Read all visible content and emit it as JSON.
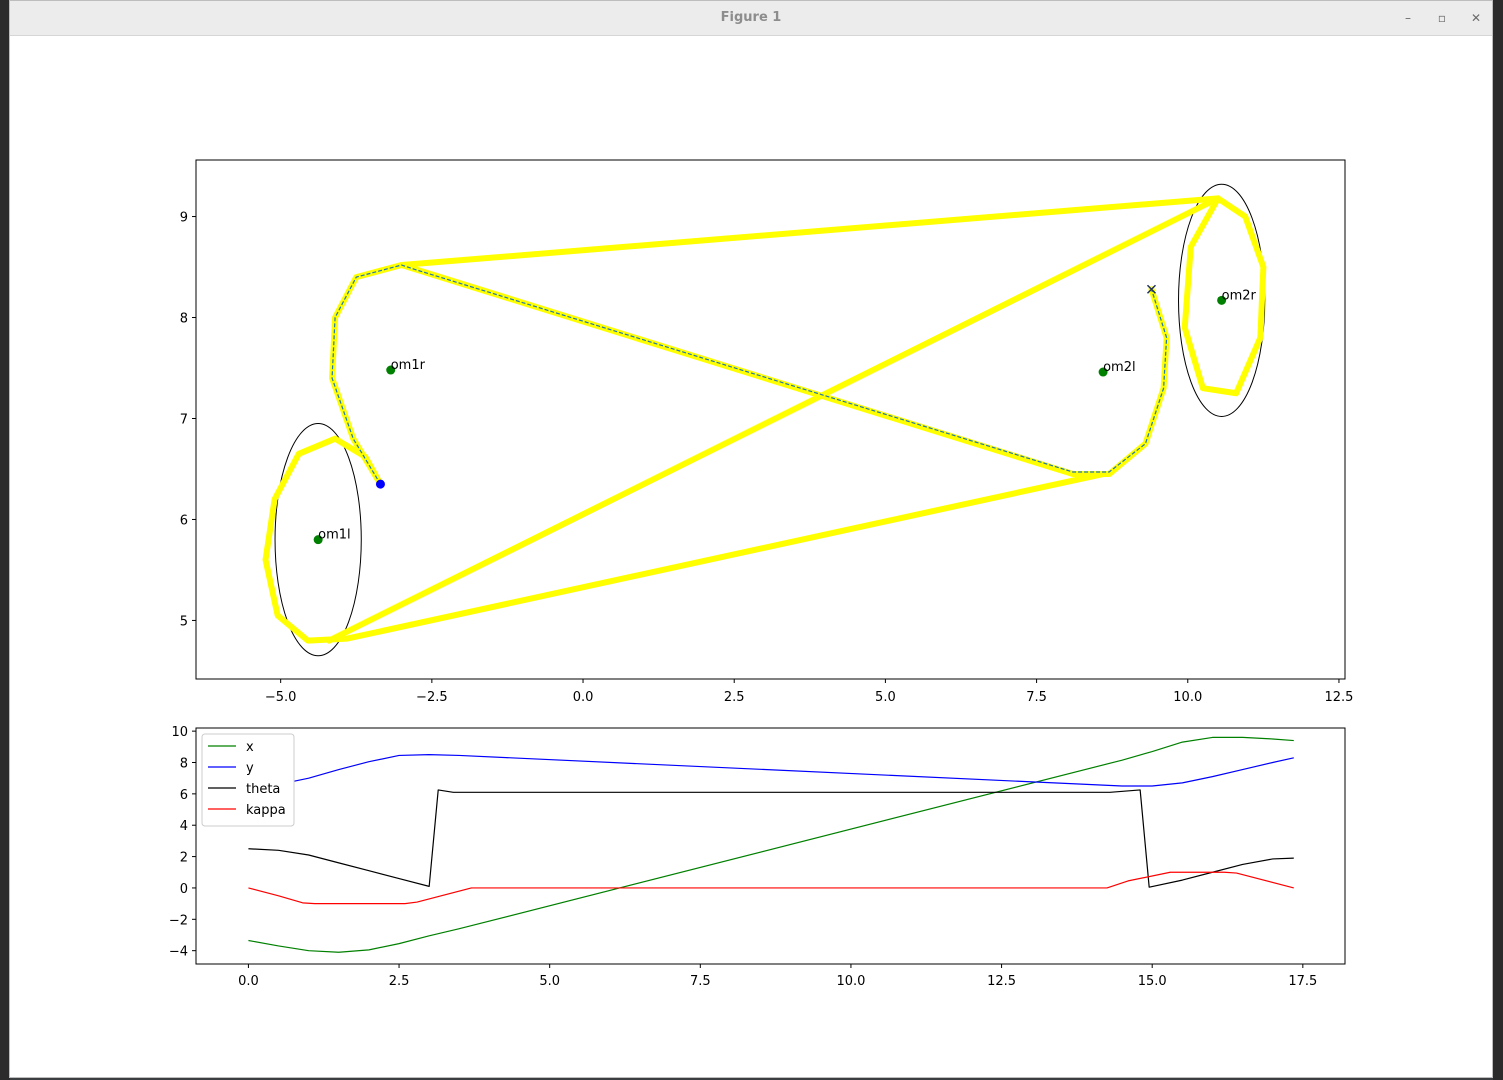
{
  "window": {
    "title": "Figure 1",
    "minimize_glyph": "–",
    "maximize_glyph": "▫",
    "close_glyph": "✕"
  },
  "chart_data": [
    {
      "type": "line",
      "title": "",
      "xlabel": "",
      "ylabel": "",
      "xlim": [
        -6.4,
        12.6
      ],
      "ylim": [
        4.42,
        9.56
      ],
      "xticks": [
        -5.0,
        -2.5,
        0.0,
        2.5,
        5.0,
        7.5,
        10.0,
        12.5
      ],
      "xtick_labels": [
        "−5.0",
        "−2.5",
        "0.0",
        "2.5",
        "5.0",
        "7.5",
        "10.0",
        "12.5"
      ],
      "yticks": [
        5,
        6,
        7,
        8,
        9
      ],
      "ytick_labels": [
        "5",
        "6",
        "7",
        "8",
        "9"
      ],
      "grid": false,
      "colors": {
        "candidate": "#ffff00",
        "path": "#1f77b4",
        "boundary": "#000000",
        "center": "#008000",
        "start": "#0000ff",
        "goal": "#1f2f5f"
      },
      "circles": [
        {
          "name": "om1l",
          "cx": -4.38,
          "cy": 5.8,
          "r": 1.0
        },
        {
          "name": "om1r",
          "cx": -3.18,
          "cy": 7.48,
          "r": 1.0
        },
        {
          "name": "om2l",
          "cx": 8.6,
          "cy": 7.46,
          "r": 1.0
        },
        {
          "name": "om2r",
          "cx": 10.56,
          "cy": 8.17,
          "r": 1.0
        }
      ],
      "boundary_circles": [
        {
          "cx": -4.38,
          "cy": 5.8,
          "rx": 1.15,
          "ry": 1.15
        },
        {
          "cx": 10.56,
          "cy": 8.17,
          "rx": 1.15,
          "ry": 1.15
        }
      ],
      "candidate_paths": [
        {
          "x": [
            -3.35,
            -3.6,
            -4.1,
            -4.7,
            -5.1,
            -5.25,
            -5.05,
            -4.55,
            -3.9,
            8.6
          ],
          "y": [
            6.35,
            6.62,
            6.8,
            6.65,
            6.2,
            5.6,
            5.05,
            4.8,
            4.82,
            6.45
          ]
        },
        {
          "x": [
            -4.2,
            10.5,
            10.95,
            11.25,
            11.2,
            10.8,
            10.25,
            9.95,
            10.05,
            10.5
          ],
          "y": [
            4.8,
            9.18,
            9.0,
            8.5,
            7.8,
            7.25,
            7.3,
            7.9,
            8.7,
            9.18
          ]
        },
        {
          "x": [
            -3.35,
            -3.8,
            -4.15,
            -4.1,
            -3.75,
            -3.0,
            10.5
          ],
          "y": [
            6.35,
            6.8,
            7.4,
            8.0,
            8.4,
            8.52,
            9.18
          ]
        },
        {
          "x": [
            -3.0,
            8.1,
            8.7,
            9.3,
            9.6,
            9.65,
            9.4
          ],
          "y": [
            8.52,
            6.45,
            6.45,
            6.75,
            7.3,
            7.8,
            8.28
          ]
        }
      ],
      "path": {
        "x": [
          -3.35,
          -3.8,
          -4.15,
          -4.1,
          -3.75,
          -3.0,
          -2.8,
          8.1,
          8.7,
          9.3,
          9.6,
          9.65,
          9.4
        ],
        "y": [
          6.35,
          6.8,
          7.4,
          8.0,
          8.4,
          8.52,
          8.48,
          6.47,
          6.47,
          6.75,
          7.3,
          7.8,
          8.28
        ]
      },
      "start": {
        "x": -3.35,
        "y": 6.35
      },
      "goal": {
        "x": 9.4,
        "y": 8.28
      }
    },
    {
      "type": "line",
      "title": "",
      "xlabel": "",
      "ylabel": "",
      "xlim": [
        -0.87,
        18.2
      ],
      "ylim": [
        -4.85,
        10.2
      ],
      "xticks": [
        0.0,
        2.5,
        5.0,
        7.5,
        10.0,
        12.5,
        15.0,
        17.5
      ],
      "xtick_labels": [
        "0.0",
        "2.5",
        "5.0",
        "7.5",
        "10.0",
        "12.5",
        "15.0",
        "17.5"
      ],
      "yticks": [
        -4,
        -2,
        0,
        2,
        4,
        6,
        8,
        10
      ],
      "ytick_labels": [
        "−4",
        "−2",
        "0",
        "2",
        "4",
        "6",
        "8",
        "10"
      ],
      "grid": false,
      "legend": {
        "placement": "upper-left"
      },
      "series": [
        {
          "name": "x",
          "color": "#008000",
          "x": [
            0,
            0.5,
            1.0,
            1.5,
            2.0,
            2.5,
            3.0,
            3.5,
            14.5,
            15.0,
            15.5,
            16.0,
            16.5,
            17.0,
            17.35
          ],
          "y": [
            -3.35,
            -3.7,
            -4.0,
            -4.1,
            -3.95,
            -3.55,
            -3.05,
            -2.6,
            8.15,
            8.7,
            9.3,
            9.6,
            9.6,
            9.5,
            9.4
          ]
        },
        {
          "name": "y",
          "color": "#0000ff",
          "x": [
            0,
            0.5,
            1.0,
            1.5,
            2.0,
            2.5,
            3.0,
            3.5,
            14.5,
            15.0,
            15.5,
            16.0,
            16.5,
            17.0,
            17.35
          ],
          "y": [
            6.35,
            6.6,
            7.0,
            7.55,
            8.05,
            8.45,
            8.5,
            8.45,
            6.5,
            6.5,
            6.7,
            7.1,
            7.55,
            8.0,
            8.3
          ]
        },
        {
          "name": "theta",
          "color": "#000000",
          "x": [
            0,
            0.5,
            1.0,
            1.5,
            2.0,
            2.5,
            3.0,
            3.15,
            3.4,
            3.7,
            14.3,
            14.8,
            14.95,
            15.5,
            16.0,
            16.5,
            17.0,
            17.35
          ],
          "y": [
            2.5,
            2.4,
            2.1,
            1.6,
            1.1,
            0.6,
            0.1,
            6.25,
            6.1,
            6.1,
            6.1,
            6.25,
            0.05,
            0.5,
            1.0,
            1.5,
            1.85,
            1.9
          ]
        },
        {
          "name": "kappa",
          "color": "#ff0000",
          "x": [
            0,
            0.5,
            0.9,
            1.1,
            2.6,
            2.8,
            3.7,
            14.25,
            14.6,
            15.3,
            16.2,
            16.4,
            17.35
          ],
          "y": [
            0,
            -0.5,
            -0.95,
            -1.0,
            -1.0,
            -0.9,
            0,
            0,
            0.45,
            1.0,
            1.0,
            0.95,
            0
          ]
        }
      ]
    }
  ]
}
